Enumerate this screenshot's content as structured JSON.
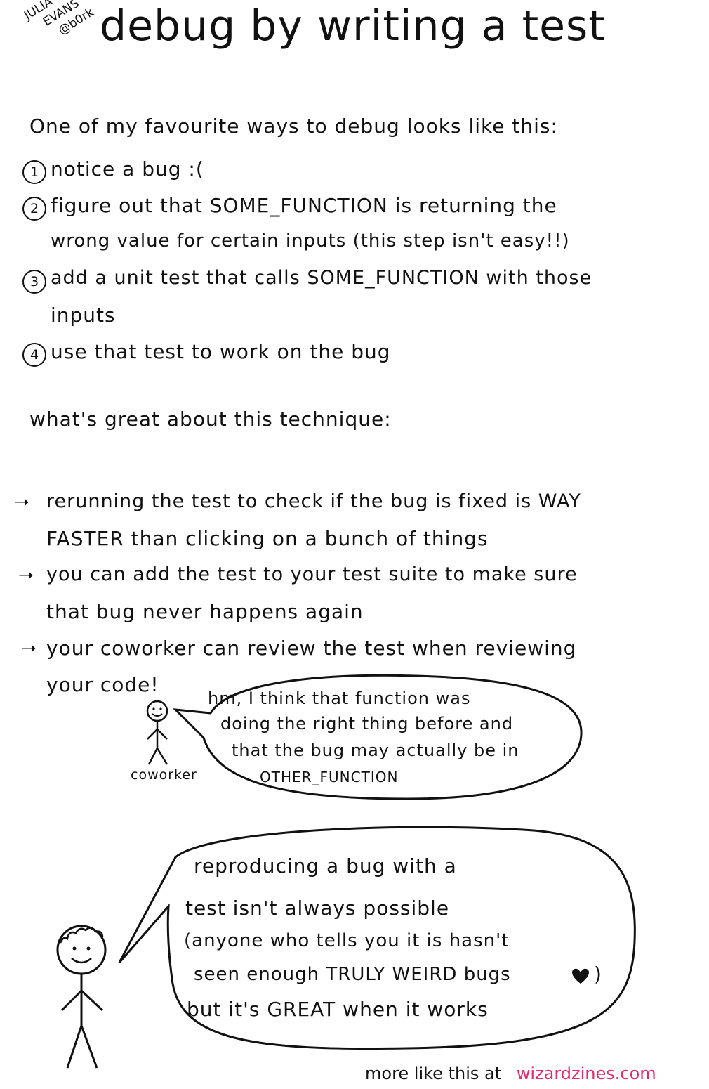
{
  "title": "debug by writing a test",
  "author": {
    "line1": "JULIA",
    "line2": "EVANS",
    "line3": "@b0rk"
  },
  "intro": "One of my favourite ways to debug looks like this:",
  "steps": [
    {
      "num": "1",
      "lines": [
        "notice a bug :("
      ]
    },
    {
      "num": "2",
      "lines": [
        "figure out that SOME_FUNCTION is returning the",
        "wrong value for certain inputs (this step isn't easy!!)"
      ]
    },
    {
      "num": "3",
      "lines": [
        "add a unit test that calls SOME_FUNCTION with those",
        "inputs"
      ]
    },
    {
      "num": "4",
      "lines": [
        "use that test to work on the bug"
      ]
    }
  ],
  "benefits_heading": "what's great about this technique:",
  "benefits": [
    {
      "lines": [
        "rerunning the test to check if the bug is fixed is WAY",
        "FASTER than clicking on a bunch of things"
      ]
    },
    {
      "lines": [
        "you can add the test to your test suite to make sure",
        "that bug never happens again"
      ]
    },
    {
      "lines": [
        "your coworker can review the test when reviewing",
        "your code!"
      ]
    }
  ],
  "coworker": {
    "label": "coworker",
    "speech": [
      "hm, I think that function was",
      "doing the right thing before and",
      "that the bug may actually be in",
      "OTHER_FUNCTION"
    ]
  },
  "caveat": {
    "speech": [
      "reproducing a bug with a",
      "test isn't always possible",
      "(anyone who tells you it is hasn't",
      "seen enough TRULY WEIRD bugs",
      "but it's GREAT when it works"
    ]
  },
  "footer": {
    "prefix": "more like this at",
    "link": "wizardzines.com"
  },
  "colors": {
    "ink": "#111111",
    "link": "#e6286e",
    "background": "#ffffff"
  },
  "icons": [
    "arrow-right-icon",
    "heart-icon",
    "stick-figure-icon"
  ]
}
